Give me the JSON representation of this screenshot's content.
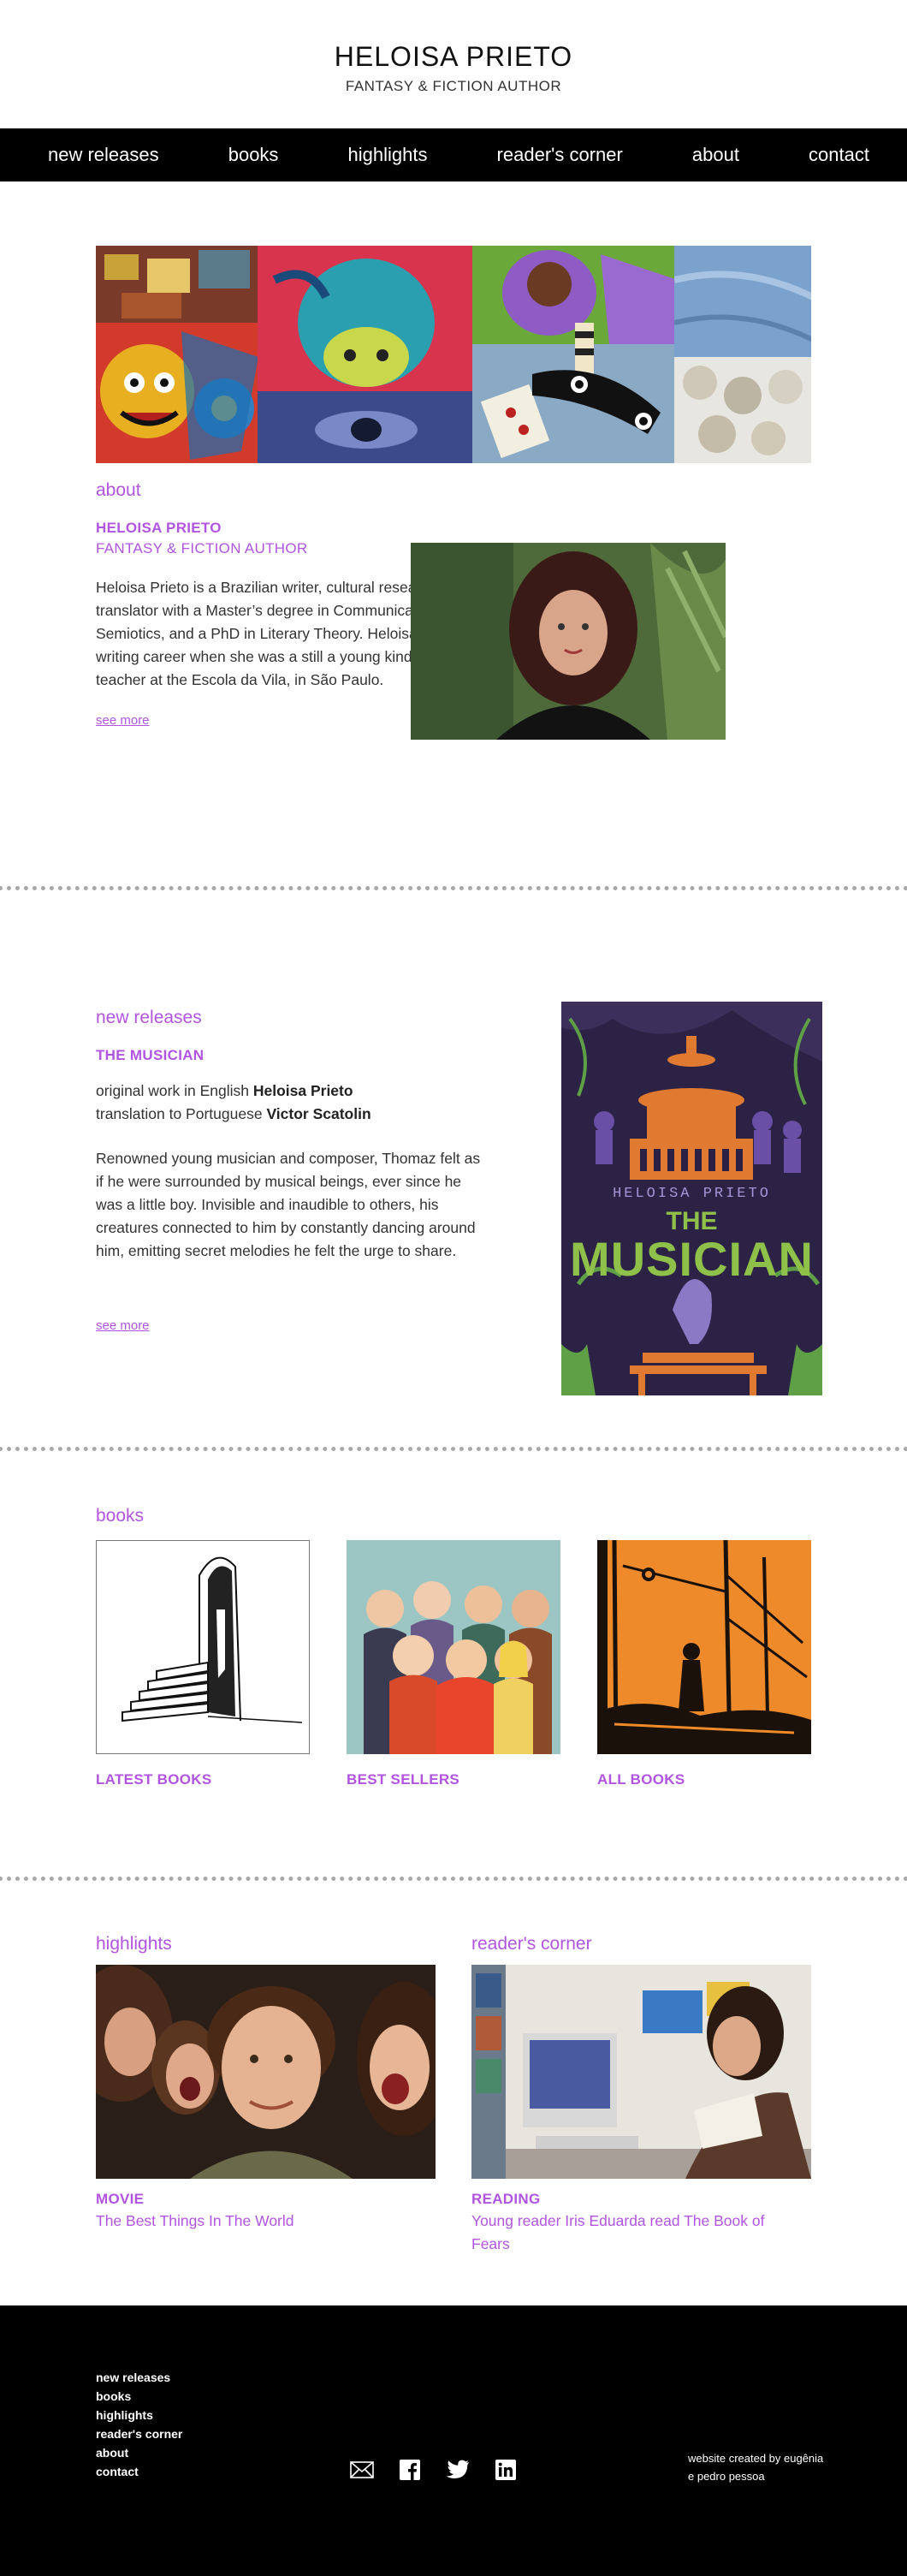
{
  "header": {
    "title": "HELOISA PRIETO",
    "subtitle": "FANTASY & FICTION AUTHOR"
  },
  "nav": [
    "new releases",
    "books",
    "highlights",
    "reader's corner",
    "about",
    "contact"
  ],
  "about": {
    "section_title": "about",
    "name": "HELOISA PRIETO",
    "role": "FANTASY & FICTION AUTHOR",
    "text": "Heloisa Prieto is a Brazilian writer, cultural researcher and translator with a Master’s degree in Communication and Semiotics, and a PhD in Literary Theory. Heloisa began her writing career when she was a still a young kindergarten teacher at the Escola da Vila, in São Paulo.",
    "see_more": "see more"
  },
  "new_release": {
    "section_title": "new releases",
    "book_title": "THE MUSICIAN",
    "line1_prefix": "original work in English ",
    "line1_name": "Heloisa Prieto",
    "line2_prefix": "translation to Portuguese ",
    "line2_name": "Victor Scatolin",
    "text": "Renowned young musician and composer, Thomaz felt as if he were surrounded by musical beings, ever since he was a little boy. Invisible and inaudible to others, his creatures connected to him by constantly dancing around him, emitting secret melodies he felt the urge to share.",
    "see_more": "see more",
    "cover_author": "HELOISA PRIETO",
    "cover_the": "THE",
    "cover_title": "MUSICIAN"
  },
  "books": {
    "section_title": "books",
    "cards": [
      "LATEST BOOKS",
      "BEST SELLERS",
      "ALL BOOKS"
    ]
  },
  "highlights": {
    "section_title": "highlights",
    "category": "MOVIE",
    "title": "The Best Things In The World"
  },
  "readers_corner": {
    "section_title": "reader's corner",
    "category": "READING",
    "title": "Young reader Iris Eduarda read The Book of Fears"
  },
  "footer": {
    "links": [
      "new releases",
      "books",
      "highlights",
      "reader's corner",
      "about",
      "contact"
    ],
    "icons": [
      "email-icon",
      "facebook-icon",
      "twitter-icon",
      "linkedin-icon"
    ],
    "credit_line1": "website created by eugênia",
    "credit_line2": "e pedro pessoa"
  },
  "colors": {
    "accent": "#b155e0",
    "nav_bg": "#000000",
    "divider": "#a8a8a8"
  }
}
